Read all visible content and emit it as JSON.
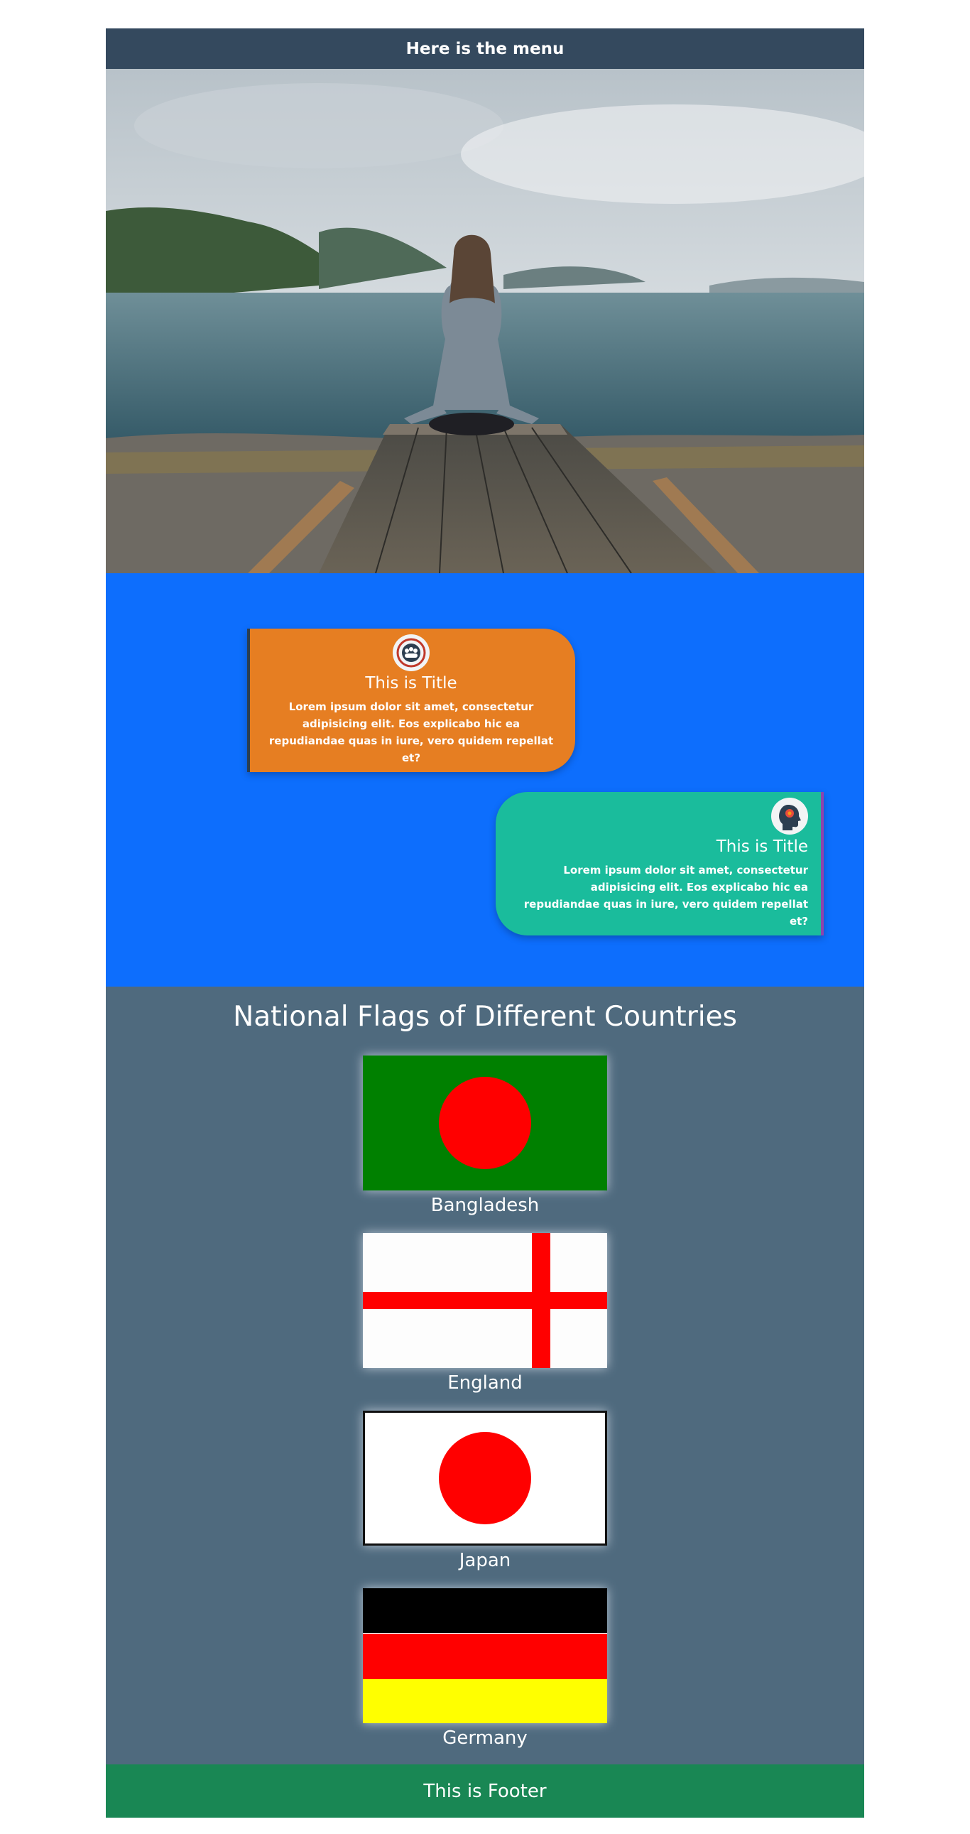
{
  "header": {
    "menu_text": "Here is the menu"
  },
  "hero": {
    "image_alt": "Woman sitting on a wooden pier facing a lake and mountains"
  },
  "cards": [
    {
      "icon": "team-icon",
      "title": "This is Title",
      "text": "Lorem ipsum dolor sit amet, consectetur adipisicing elit. Eos explicabo hic ea repudiandae quas in iure, vero quidem repellat et?",
      "color": "#e67e22"
    },
    {
      "icon": "head-gear-icon",
      "title": "This is Title",
      "text": "Lorem ipsum dolor sit amet, consectetur adipisicing elit. Eos explicabo hic ea repudiandae quas in iure, vero quidem repellat et?",
      "color": "#1abc9c"
    }
  ],
  "flags_section": {
    "title": "National Flags of Different Countries",
    "flags": [
      {
        "name": "Bangladesh",
        "colors": [
          "#008000",
          "#ff0000"
        ]
      },
      {
        "name": "England",
        "colors": [
          "#ffffff",
          "#ff0000"
        ]
      },
      {
        "name": "Japan",
        "colors": [
          "#ffffff",
          "#ff0000"
        ]
      },
      {
        "name": "Germany",
        "colors": [
          "#000000",
          "#ff0000",
          "#ffff00"
        ]
      }
    ]
  },
  "footer": {
    "text": "This is Footer"
  },
  "colors": {
    "menu_bg": "#34495e",
    "cards_bg": "#0d6efd",
    "flags_bg": "#4f6a7e",
    "footer_bg": "#198754"
  }
}
